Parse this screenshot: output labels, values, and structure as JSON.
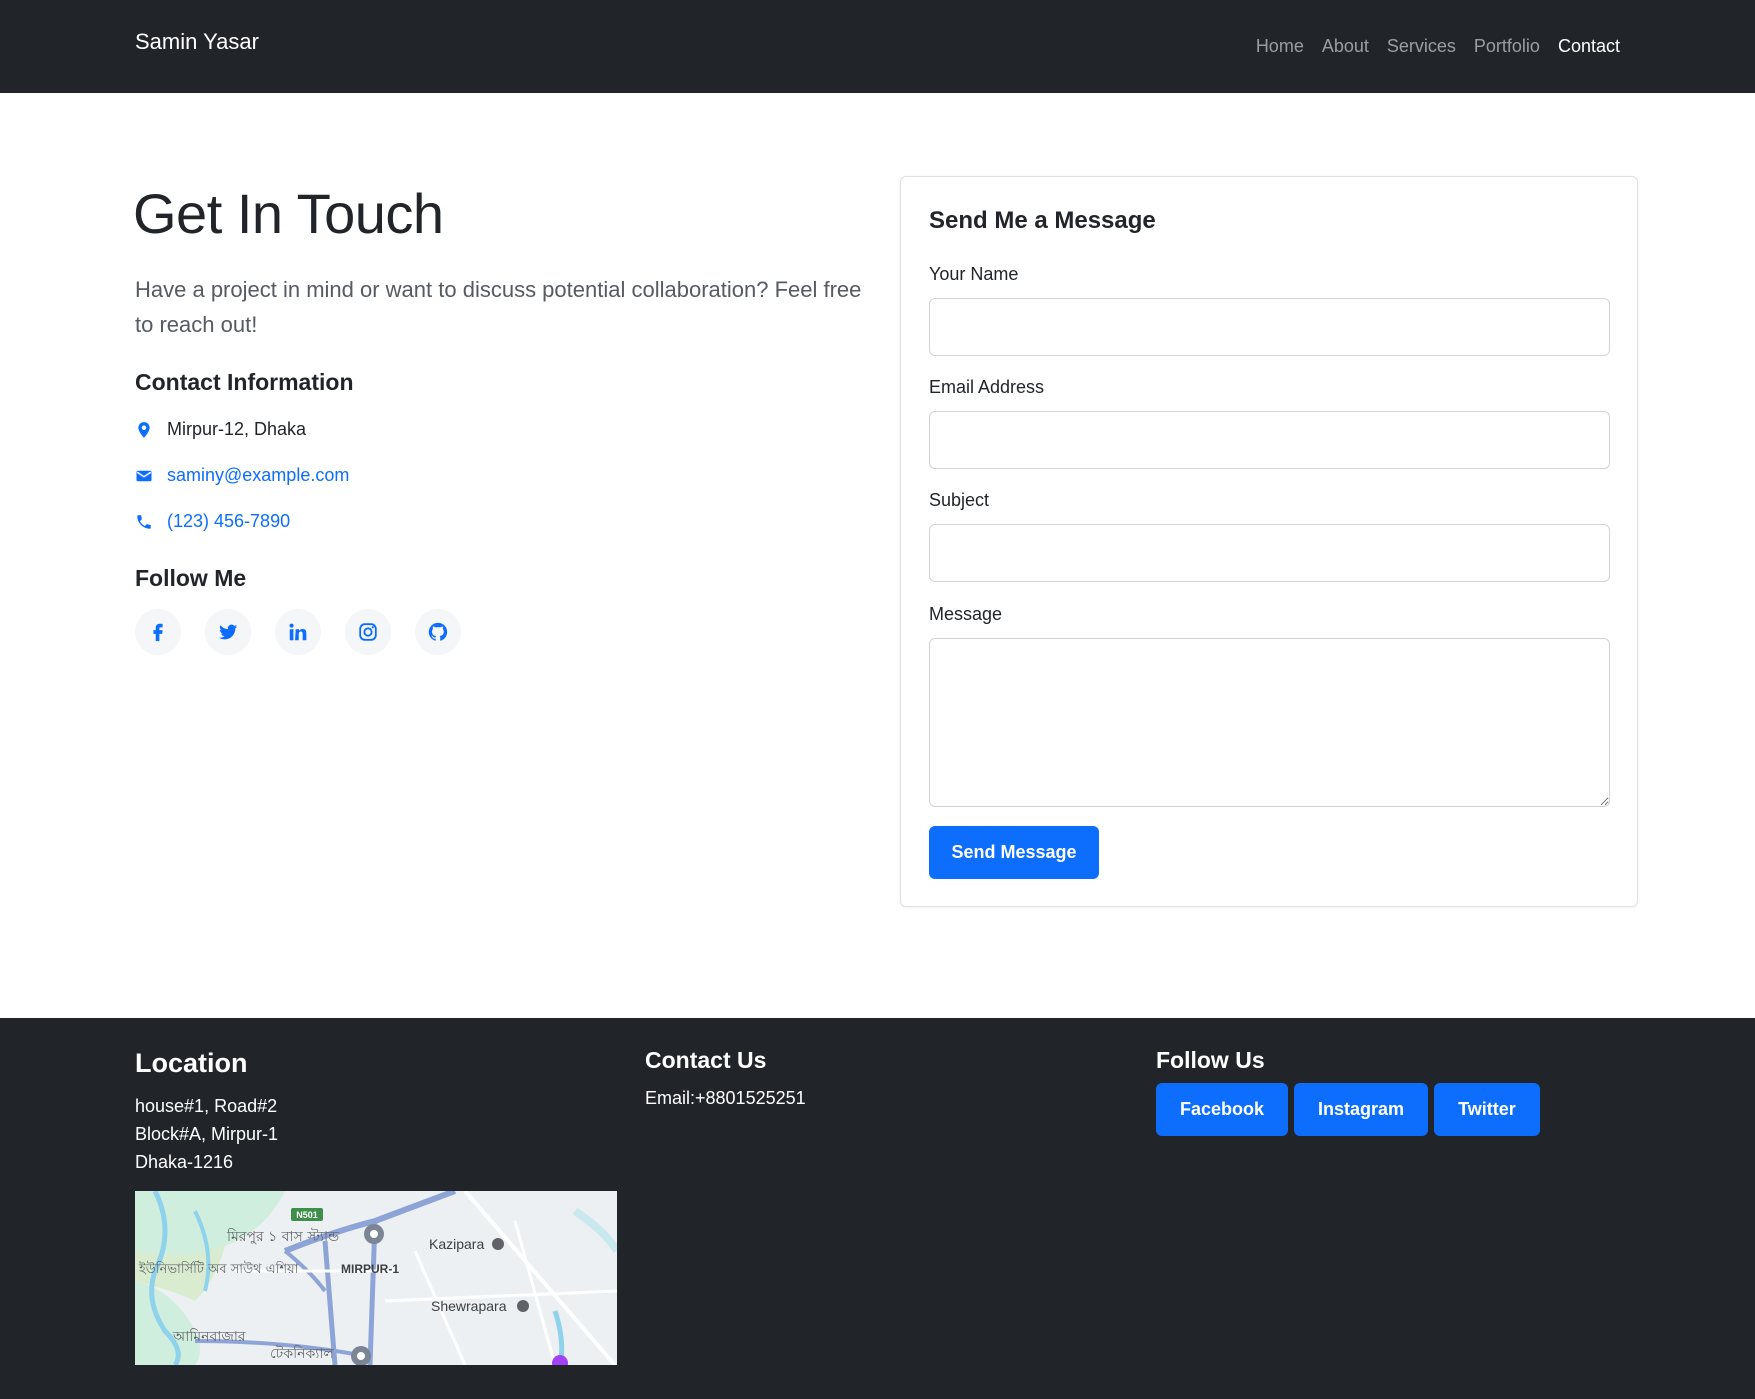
{
  "navbar": {
    "brand": "Samin Yasar",
    "links": [
      {
        "label": "Home"
      },
      {
        "label": "About"
      },
      {
        "label": "Services"
      },
      {
        "label": "Portfolio"
      },
      {
        "label": "Contact",
        "active": true
      }
    ]
  },
  "hero": {
    "title": "Get In Touch",
    "lead": "Have a project in mind or want to discuss potential collaboration? Feel free to reach out!"
  },
  "contact_info": {
    "heading": "Contact Information",
    "address": "Mirpur-12, Dhaka",
    "email": "saminy@example.com",
    "phone": "(123) 456-7890"
  },
  "follow_me": {
    "heading": "Follow Me",
    "icons": [
      "facebook-icon",
      "twitter-icon",
      "linkedin-icon",
      "instagram-icon",
      "github-icon"
    ]
  },
  "form": {
    "title": "Send Me a Message",
    "name_label": "Your Name",
    "name_value": "",
    "email_label": "Email Address",
    "email_value": "",
    "subject_label": "Subject",
    "subject_value": "",
    "message_label": "Message",
    "message_value": "",
    "submit_label": "Send Message"
  },
  "footer": {
    "location_heading": "Location",
    "address_lines": [
      "house#1, Road#2",
      "Block#A, Mirpur-1",
      "Dhaka-1216"
    ],
    "map": {
      "road_badge": "N501",
      "labels": [
        "মিরপুর ১ বাস স্ট্যান্ড",
        "Kazipara",
        "ইউনিভার্সিটি অব সাউথ এশিয়া",
        "MIRPUR-1",
        "Shewrapara",
        "আমিনবাজার",
        "টেকনিক্যাল"
      ]
    },
    "contact_heading": "Contact Us",
    "email_line": "Email:+8801525251",
    "follow_heading": "Follow Us",
    "buttons": [
      {
        "label": "Facebook"
      },
      {
        "label": "Instagram"
      },
      {
        "label": "Twitter"
      }
    ]
  },
  "colors": {
    "dark": "#212529",
    "primary": "#0d6efd",
    "muted_text": "#555b61"
  }
}
